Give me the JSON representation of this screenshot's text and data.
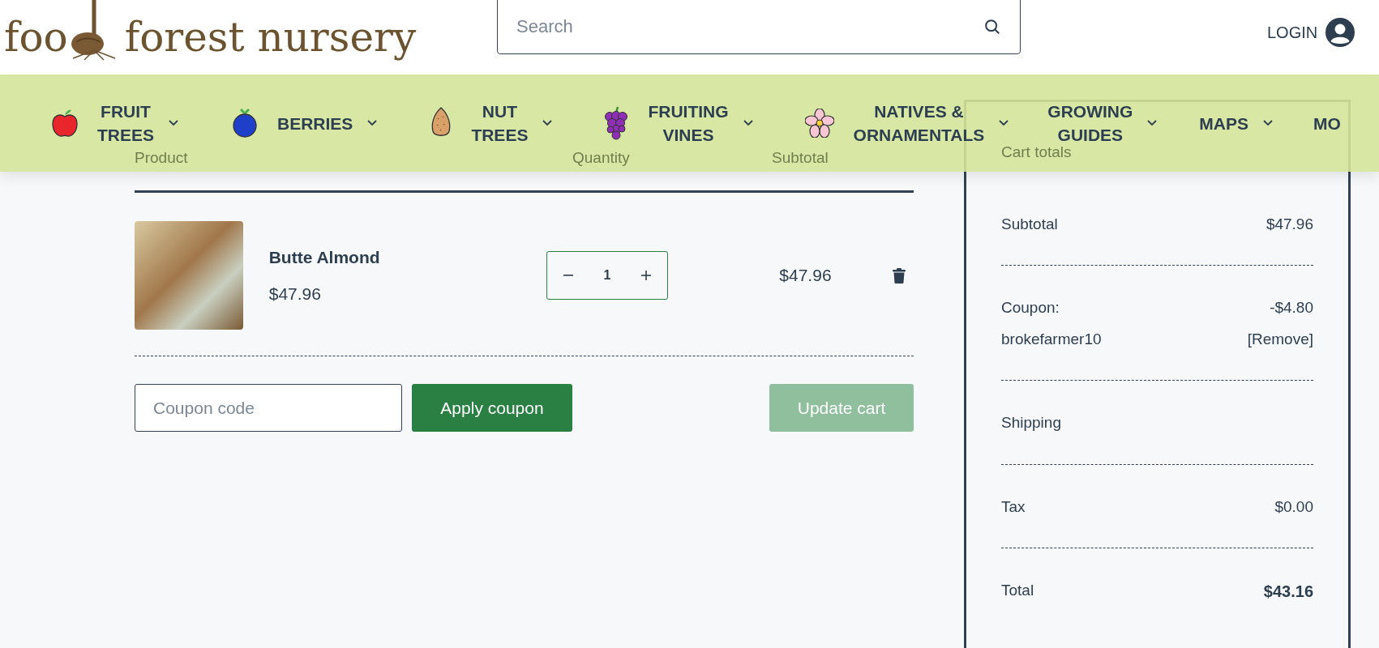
{
  "header": {
    "logo": {
      "part_1": "foo",
      "part_2": "forest nursery"
    },
    "search": {
      "placeholder": "Search"
    },
    "login": "LOGIN"
  },
  "nav": {
    "items": [
      {
        "label": "FRUIT\nTREES",
        "kind": "apple",
        "dropdown": true
      },
      {
        "label": "BERRIES",
        "kind": "berry",
        "dropdown": true
      },
      {
        "label": "NUT\nTREES",
        "kind": "almond",
        "dropdown": true
      },
      {
        "label": "FRUITING\nVINES",
        "kind": "grapes",
        "dropdown": true
      },
      {
        "label": "NATIVES &\nORNAMENTALS",
        "kind": "flower",
        "dropdown": true
      },
      {
        "label": "GROWING\nGUIDES",
        "kind": "text",
        "dropdown": true
      },
      {
        "label": "MAPS",
        "kind": "text",
        "dropdown": true
      },
      {
        "label": "MO",
        "kind": "text",
        "dropdown": false
      }
    ]
  },
  "cart": {
    "columns": [
      "Product",
      "Quantity",
      "Subtotal"
    ],
    "items": [
      {
        "name": "Butte Almond",
        "price": "$47.96",
        "quantity": "1",
        "subtotal": "$47.96"
      }
    ],
    "coupon": {
      "placeholder": "Coupon code"
    },
    "apply_button": "Apply coupon",
    "update_button": {
      "label": "Update cart",
      "disabled": true
    }
  },
  "totals": {
    "title": "Cart totals",
    "rows": [
      {
        "kind": "line",
        "label": "Subtotal",
        "value": "$47.96"
      },
      {
        "kind": "coupon",
        "label": "Coupon:",
        "code": "brokefarmer10",
        "value": "-$4.80",
        "action": "[Remove]"
      },
      {
        "kind": "line",
        "label": "Shipping"
      },
      {
        "kind": "line",
        "label": "Tax",
        "value": "$0.00"
      },
      {
        "kind": "total",
        "label": "Total",
        "value": "$43.16"
      }
    ]
  }
}
